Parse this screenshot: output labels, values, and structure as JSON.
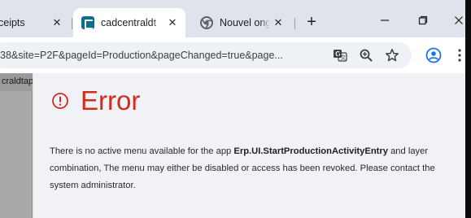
{
  "tabs": [
    {
      "title": "ceipts",
      "close": "✕"
    },
    {
      "title": "cadcentraldt",
      "close": "✕",
      "active": true
    },
    {
      "title": "Nouvel ongl",
      "close": "✕"
    }
  ],
  "new_tab": "+",
  "window_controls": {
    "minimize": "—",
    "maximize": "❐",
    "close": "✕"
  },
  "address_bar": {
    "url": "38&site=P2F&pageId=Production&pageChanged=true&page..."
  },
  "icons": {
    "translate": "translate-icon",
    "zoom": "zoom-icon",
    "bookmark": "star-icon",
    "profile": "account-icon",
    "menu": "more-vertical-icon",
    "error": "error-circle-icon"
  },
  "left_panel": {
    "label": "craldtap"
  },
  "error": {
    "title": "Error",
    "message_before": "There is no active menu available for the app ",
    "app_name": "Erp.UI.StartProductionActivityEntry",
    "message_after": " and layer combination, The menu may either be disabled or access has been revoked. Please contact the system administrator."
  },
  "colors": {
    "error_red": "#d52b1e",
    "tabstrip": "#dfe3eb",
    "content_bg": "#f1f2f5"
  }
}
